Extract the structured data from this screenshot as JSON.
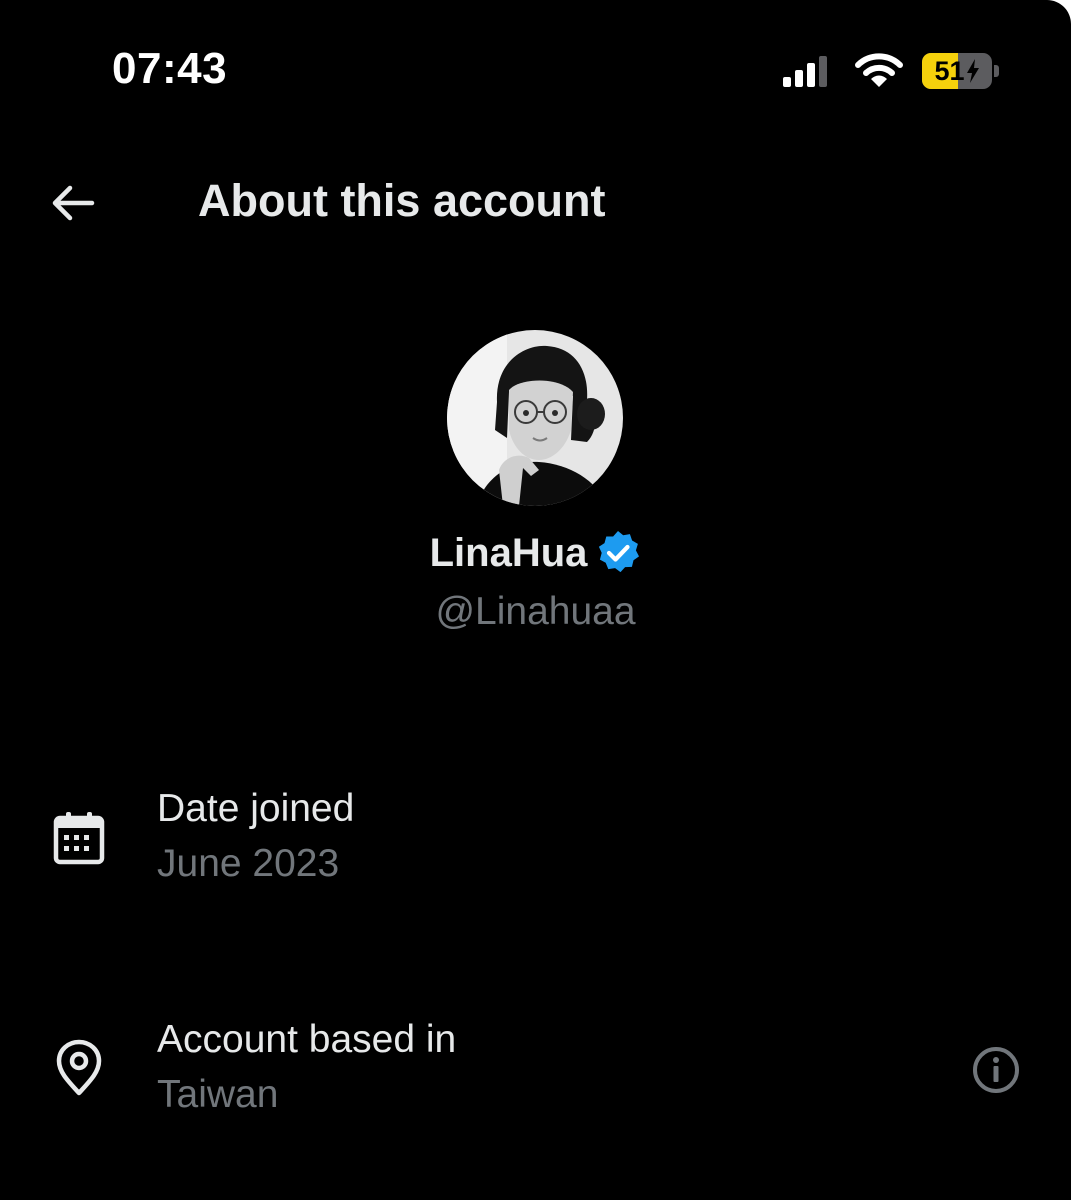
{
  "status_bar": {
    "time": "07:43",
    "battery_level": "51",
    "battery_percent": 51,
    "charging": true,
    "icons": [
      "cellular-signal-icon",
      "wifi-icon",
      "battery-icon",
      "charging-bolt-icon"
    ],
    "battery_fill_color": "#f5d10c"
  },
  "header": {
    "title": "About this account",
    "back_icon": "arrow-left-icon"
  },
  "profile": {
    "display_name": "LinaHua",
    "handle": "@Linahuaa",
    "verified": true,
    "verified_badge_color": "#1d9bf0",
    "avatar_alt": "Profile photo"
  },
  "details": {
    "date_joined": {
      "icon": "calendar-icon",
      "label": "Date joined",
      "value": "June 2023"
    },
    "account_based_in": {
      "icon": "location-pin-icon",
      "label": "Account based in",
      "value": "Taiwan",
      "info_icon": "info-circle-icon"
    }
  },
  "colors": {
    "background": "#000000",
    "primary_text": "#e7e9ea",
    "secondary_text": "#71767b",
    "accent": "#1d9bf0"
  }
}
